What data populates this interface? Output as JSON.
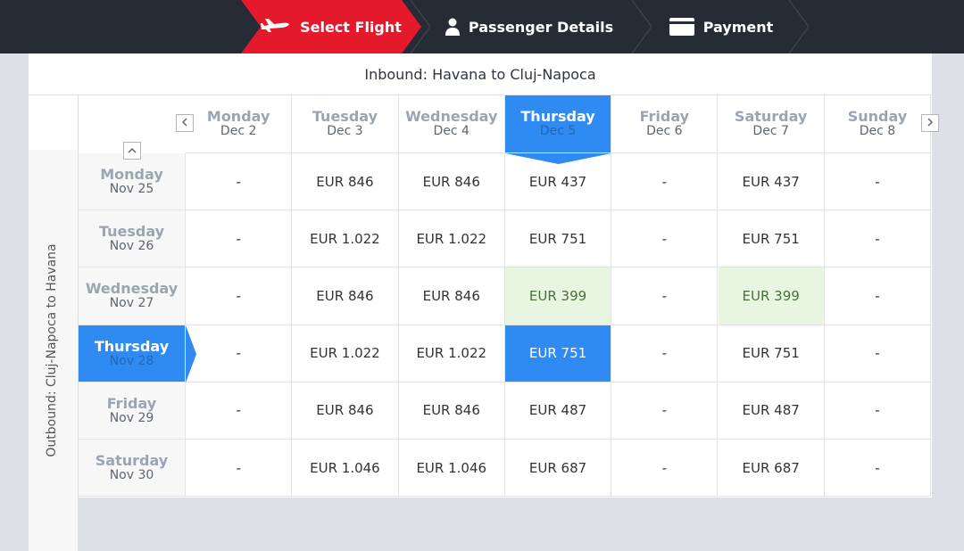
{
  "steps": {
    "select_flight": "Select Flight",
    "passenger_details": "Passenger Details",
    "payment": "Payment"
  },
  "inbound_title": "Inbound: Havana to Cluj-Napoca",
  "outbound_label": "Outbound: Cluj-Napoca to Havana",
  "columns": [
    {
      "day": "Monday",
      "date": "Dec 2"
    },
    {
      "day": "Tuesday",
      "date": "Dec 3"
    },
    {
      "day": "Wednesday",
      "date": "Dec 4"
    },
    {
      "day": "Thursday",
      "date": "Dec 5"
    },
    {
      "day": "Friday",
      "date": "Dec 6"
    },
    {
      "day": "Saturday",
      "date": "Dec 7"
    },
    {
      "day": "Sunday",
      "date": "Dec 8"
    }
  ],
  "rows": [
    {
      "day": "Monday",
      "date": "Nov 25",
      "prices": [
        "-",
        "EUR 846",
        "EUR 846",
        "EUR 437",
        "-",
        "EUR 437",
        "-"
      ]
    },
    {
      "day": "Tuesday",
      "date": "Nov 26",
      "prices": [
        "-",
        "EUR 1.022",
        "EUR 1.022",
        "EUR 751",
        "-",
        "EUR 751",
        "-"
      ]
    },
    {
      "day": "Wednesday",
      "date": "Nov 27",
      "prices": [
        "-",
        "EUR 846",
        "EUR 846",
        "EUR 399",
        "-",
        "EUR 399",
        "-"
      ]
    },
    {
      "day": "Thursday",
      "date": "Nov 28",
      "prices": [
        "-",
        "EUR 1.022",
        "EUR 1.022",
        "EUR 751",
        "-",
        "EUR 751",
        "-"
      ]
    },
    {
      "day": "Friday",
      "date": "Nov 29",
      "prices": [
        "-",
        "EUR 846",
        "EUR 846",
        "EUR 487",
        "-",
        "EUR 487",
        "-"
      ]
    },
    {
      "day": "Saturday",
      "date": "Nov 30",
      "prices": [
        "-",
        "EUR 1.046",
        "EUR 1.046",
        "EUR 687",
        "-",
        "EUR 687",
        "-"
      ]
    }
  ],
  "selected_column": 3,
  "selected_row": 3,
  "cheapest_cells": [
    [
      2,
      3
    ],
    [
      2,
      5
    ]
  ],
  "icons": {
    "select_flight": "airplane-icon",
    "passenger_details": "person-icon",
    "payment": "credit-card-icon",
    "prev": "chevron-left-icon",
    "next": "chevron-right-icon",
    "up": "chevron-up-icon"
  },
  "colors": {
    "active_step": "#e4192c",
    "header_bg": "#262b36",
    "selected": "#2f8bf1",
    "cheapest": "#e8f6e1"
  }
}
